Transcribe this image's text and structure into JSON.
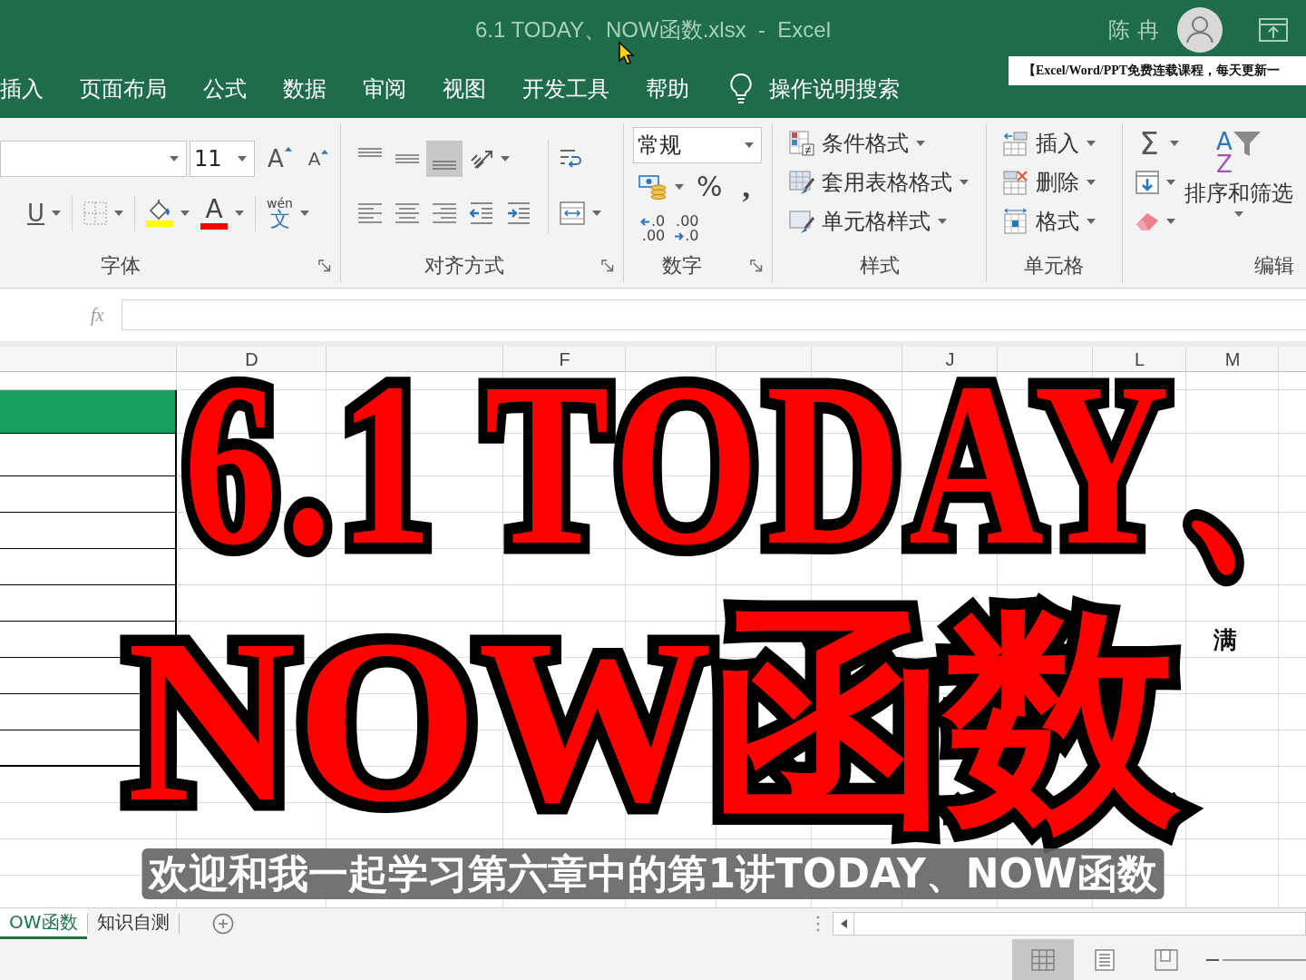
{
  "title_bar": {
    "title": "6.1 TODAY、NOW函数.xlsx  -  Excel",
    "user_name": "陈 冉"
  },
  "ribbon_tabs": [
    {
      "label": "插入",
      "selected": false
    },
    {
      "label": "页面布局",
      "selected": false
    },
    {
      "label": "公式",
      "selected": false
    },
    {
      "label": "数据",
      "selected": false
    },
    {
      "label": "审阅",
      "selected": false
    },
    {
      "label": "视图",
      "selected": false
    },
    {
      "label": "开发工具",
      "selected": false
    },
    {
      "label": "帮助",
      "selected": false
    }
  ],
  "tell_me": "操作说明搜索",
  "promo_banner": "【Excel/Word/PPT免费连载课程，每天更新一",
  "ribbon": {
    "font": {
      "label": "字体",
      "size": "11",
      "grow": "A",
      "shrink": "A",
      "underline": "U",
      "font_color": "A",
      "phonetic": {
        "top": "wén",
        "bottom": "文"
      }
    },
    "alignment": {
      "label": "对齐方式",
      "vertical": [
        {
          "kind": "top",
          "selected": false
        },
        {
          "kind": "middle",
          "selected": false
        },
        {
          "kind": "bottom",
          "selected": true
        }
      ],
      "horizontal": [
        {
          "kind": "left",
          "selected": false
        },
        {
          "kind": "center",
          "selected": false
        },
        {
          "kind": "right",
          "selected": false
        }
      ]
    },
    "number": {
      "label": "数字",
      "format": "常规",
      "percent": "%",
      "comma": ",",
      "increase_decimal": {
        "top": ".0",
        "bottom": ".00"
      },
      "decrease_decimal": {
        "top": ".00",
        "bottom": ".0"
      }
    },
    "styles": {
      "label": "样式",
      "items": [
        {
          "kind": "conditional",
          "label": "条件格式"
        },
        {
          "kind": "table",
          "label": "套用表格格式"
        },
        {
          "kind": "cell",
          "label": "单元格样式"
        }
      ]
    },
    "cells": {
      "label": "单元格",
      "items": [
        {
          "kind": "insert",
          "label": "插入"
        },
        {
          "kind": "delete",
          "label": "删除"
        },
        {
          "kind": "format",
          "label": "格式"
        }
      ]
    },
    "editing": {
      "label": "编辑",
      "sum": "Σ",
      "sort_letters": [
        "A",
        "Z"
      ],
      "sort_label": "排序和筛选"
    }
  },
  "formula_bar": {
    "fx": "fx"
  },
  "sheet": {
    "column_headers": [
      "D",
      "F",
      "J",
      "L",
      "M"
    ],
    "cell_text": "满"
  },
  "sheet_tabs": [
    {
      "label": "OW函数",
      "selected": true
    },
    {
      "label": "知识自测",
      "selected": false
    }
  ],
  "status_bar": {
    "views": [
      {
        "kind": "normal",
        "selected": true
      },
      {
        "kind": "page_layout",
        "selected": false
      },
      {
        "kind": "page_break",
        "selected": false
      }
    ]
  },
  "title_overlay": {
    "lines": [
      "6.1 TODAY、",
      "NOW函数"
    ]
  },
  "subtitle": "欢迎和我一起学习第六章中的第1讲TODAY、NOW函数"
}
